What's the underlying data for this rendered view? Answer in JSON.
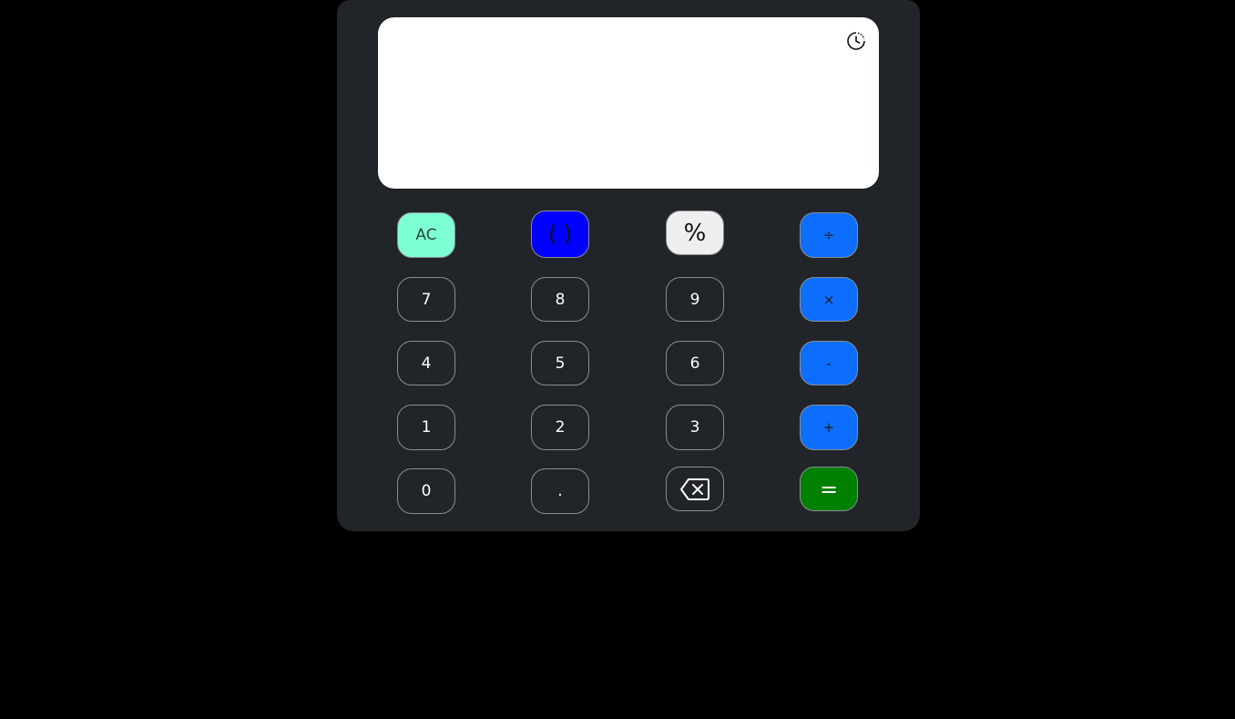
{
  "display": {
    "expression": "",
    "result": "",
    "history_icon": "history-clock-icon"
  },
  "keys": {
    "ac": "AC",
    "paren": "( )",
    "percent": "%",
    "divide": "÷",
    "seven": "7",
    "eight": "8",
    "nine": "9",
    "multiply": "×",
    "four": "4",
    "five": "5",
    "six": "6",
    "minus": "-",
    "one": "1",
    "two": "2",
    "three": "3",
    "plus": "+",
    "zero": "0",
    "dot": ".",
    "backspace_icon": "backspace-icon",
    "equals": "="
  },
  "colors": {
    "panel": "#212428",
    "display": "#ffffff",
    "operator": "#0d6efd",
    "ac": "#7fffd4",
    "paren": "#0000ff",
    "percent": "#efefef",
    "equals": "#008000"
  }
}
